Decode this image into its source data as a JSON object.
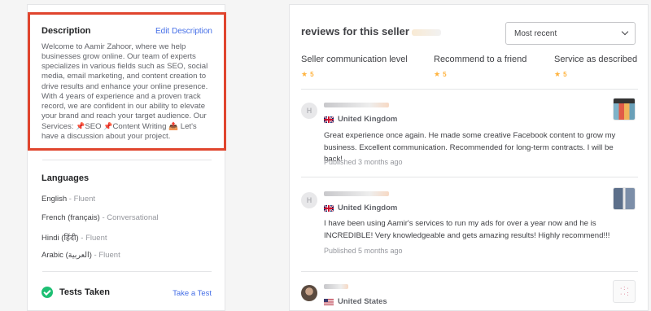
{
  "description": {
    "heading": "Description",
    "edit_label": "Edit Description",
    "text_before_pins": "Welcome to Aamir Zahoor, where we help businesses grow online. Our team of experts specializes in various fields such as SEO, social media, email marketing, and content creation to drive results and enhance your online presence. With 4 years of experience and a proven track record, we are confident in our ability to elevate your brand and reach your target audience. Our Services: ",
    "service1": "SEO ",
    "service2": "Content Writing ",
    "text_after": " Let's have a discussion about your project."
  },
  "languages": {
    "heading": "Languages",
    "items": [
      {
        "name": "English",
        "sep": " - ",
        "level": "Fluent"
      },
      {
        "name": "French (français)",
        "sep": " - ",
        "level": "Conversational"
      },
      {
        "name": "Hindi (हिंदी)",
        "sep": " - ",
        "level": "Fluent"
      },
      {
        "name": "Arabic (العربية)",
        "sep": " - ",
        "level": "Fluent"
      }
    ]
  },
  "tests": {
    "heading": "Tests Taken",
    "action_label": "Take a Test"
  },
  "reviews": {
    "title": "reviews for this seller",
    "sort_selected": "Most recent",
    "metrics": [
      {
        "label": "Seller communication level",
        "rating": "5"
      },
      {
        "label": "Recommend to a friend",
        "rating": "5"
      },
      {
        "label": "Service as described",
        "rating": "5"
      }
    ],
    "star_icon": "★",
    "accent_color": "#ffb33e",
    "items": [
      {
        "avatar_letter": "H",
        "country": "United Kingdom",
        "flag": "uk-flag-icon",
        "text": "Great experience once again. He made some creative Facebook content to grow my business. Excellent communication. Recommended for long-term contracts. I will be back!",
        "published": "Published 3 months ago"
      },
      {
        "avatar_letter": "H",
        "country": "United Kingdom",
        "flag": "uk-flag-icon",
        "text": "I have been using Aamir's services to run my ads for over a year now and he is INCREDIBLE! Very knowledgeable and gets amazing results! Highly recommend!!!",
        "published": "Published 5 months ago"
      },
      {
        "avatar_letter": "",
        "country": "United States",
        "flag": "us-flag-icon"
      }
    ]
  }
}
